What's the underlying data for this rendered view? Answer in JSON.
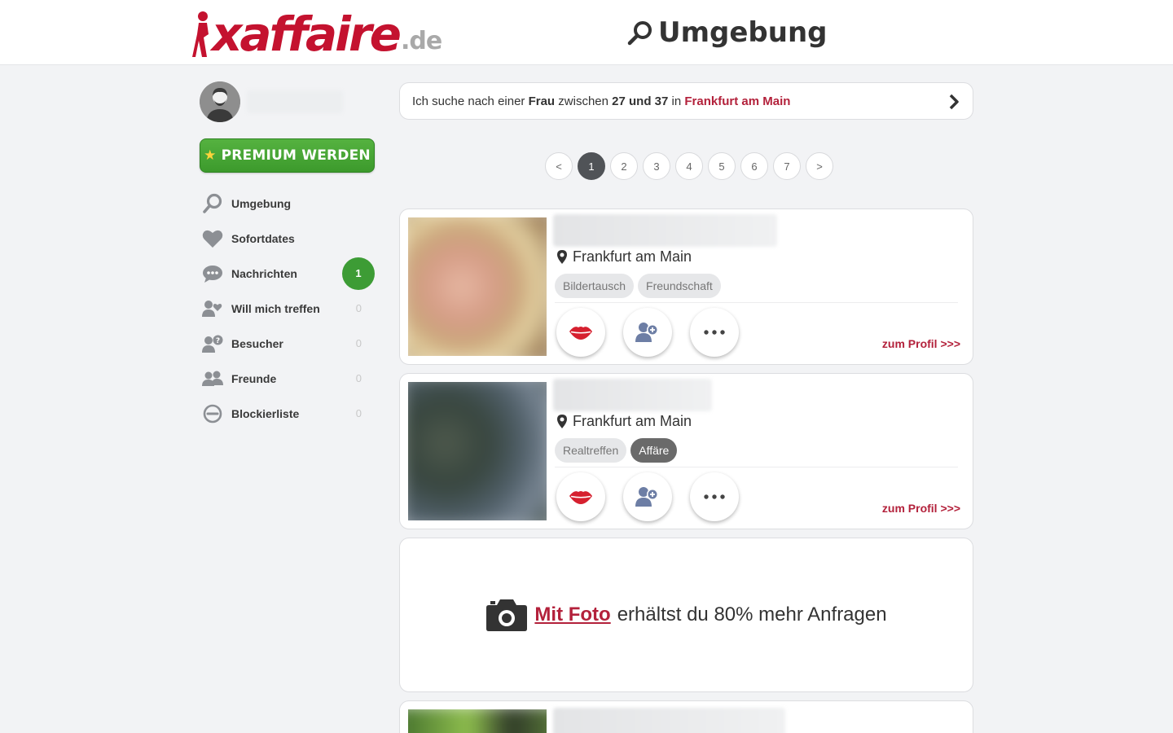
{
  "header": {
    "logo_text": "xaffaire",
    "logo_tld": ".de",
    "title": "Umgebung",
    "title_icon": "search-icon"
  },
  "sidebar": {
    "premium_label": "PREMIUM WERDEN",
    "nav": [
      {
        "label": "Umgebung",
        "icon": "search-icon",
        "count": null
      },
      {
        "label": "Sofortdates",
        "icon": "heart-icon",
        "count": null
      },
      {
        "label": "Nachrichten",
        "icon": "chat-icon",
        "badge": "1"
      },
      {
        "label": "Will mich treffen",
        "icon": "user-heart-icon",
        "count": "0"
      },
      {
        "label": "Besucher",
        "icon": "user-question-icon",
        "count": "0"
      },
      {
        "label": "Freunde",
        "icon": "users-icon",
        "count": "0"
      },
      {
        "label": "Blockierliste",
        "icon": "block-icon",
        "count": "0"
      }
    ]
  },
  "search": {
    "prefix": "Ich suche nach einer",
    "gender": "Frau",
    "between": "zwischen",
    "age_range": "27 und 37",
    "in": "in",
    "city": "Frankfurt am Main"
  },
  "pagination": {
    "prev": "<",
    "pages": [
      "1",
      "2",
      "3",
      "4",
      "5",
      "6",
      "7"
    ],
    "current": "1",
    "next": ">"
  },
  "profiles": [
    {
      "location": "Frankfurt am Main",
      "tags": [
        "Bildertausch",
        "Freundschaft"
      ],
      "link": "zum Profil >>>"
    },
    {
      "location": "Frankfurt am Main",
      "tags": [
        "Realtreffen",
        "Affäre"
      ],
      "link": "zum Profil >>>"
    }
  ],
  "promo": {
    "link_text": "Mit Foto",
    "rest_text": "erhältst du 80% mehr Anfragen"
  },
  "colors": {
    "brand_red": "#c4122f",
    "link_red": "#b3213b",
    "premium_green": "#4aa838",
    "badge_green": "#3d9c35"
  }
}
